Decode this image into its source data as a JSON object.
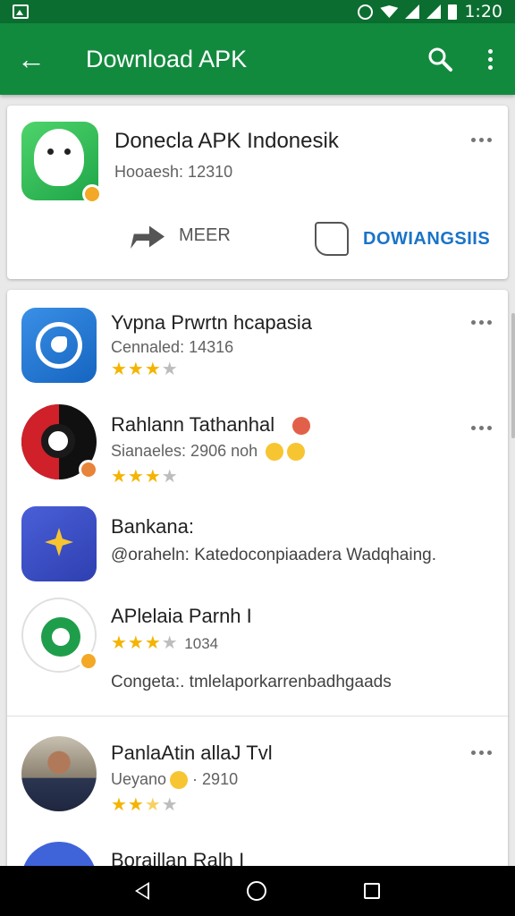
{
  "status_bar": {
    "time": "1:20"
  },
  "app_bar": {
    "title": "Download APK"
  },
  "featured": {
    "name": "Donecla APK Indonesik",
    "subtitle": "Hooaesh: 12310",
    "share_label": "MEER",
    "download_label": "DOWIANGSIIS"
  },
  "apps": [
    {
      "name": "Yvpna Prwrtn hcapasia",
      "meta": "Cennaled: 14316",
      "rating": 3
    },
    {
      "name": "Rahlann Tathanhal",
      "meta": "Sianaeles: 2906 noh",
      "rating": 3
    },
    {
      "name": "Bankana:",
      "line": "@oraheln: Katedoconpiaadera Wadqhaing."
    },
    {
      "name": "APlelaia Parnh I",
      "meta": "1034",
      "line": "Congeta:. tmlelaporkarrenbadhgaads",
      "rating": 3
    },
    {
      "name": "PanlaAtin allaJ Tvl",
      "meta": "Ueyano",
      "meta2": "2910",
      "rating": 2.5
    },
    {
      "name": "Boraillan Ralh I"
    }
  ],
  "colors": {
    "accent": "#128a3e",
    "status": "#0b6e30",
    "link": "#1a73c8",
    "star": "#f4b400"
  }
}
